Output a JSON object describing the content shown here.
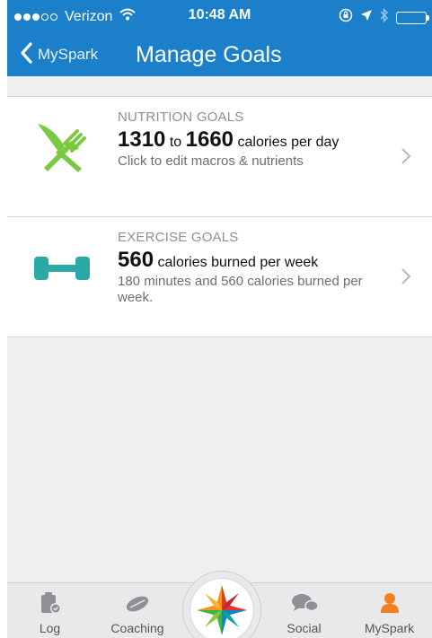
{
  "status_bar": {
    "carrier": "Verizon",
    "time": "10:48 AM"
  },
  "nav": {
    "back_label": "MySpark",
    "title": "Manage Goals"
  },
  "nutrition": {
    "label": "NUTRITION GOALS",
    "min": "1310",
    "to": "to",
    "max": "1660",
    "unit": "calories per day",
    "sub": "Click to edit macros & nutrients"
  },
  "exercise": {
    "label": "EXERCISE GOALS",
    "value": "560",
    "unit": "calories burned per week",
    "sub": "180 minutes and 560 calories burned per week."
  },
  "tabs": [
    {
      "label": "Log",
      "icon": "log-icon"
    },
    {
      "label": "Coaching",
      "icon": "coaching-icon"
    },
    {
      "label": "",
      "icon": "spark-star-icon"
    },
    {
      "label": "Social",
      "icon": "social-icon"
    },
    {
      "label": "MySpark",
      "icon": "person-icon"
    }
  ],
  "colors": {
    "header": "#1b7fc9",
    "nutrition_icon": "#7ac943",
    "exercise_icon": "#2aa9a6",
    "active_tab": "#f57f20"
  }
}
